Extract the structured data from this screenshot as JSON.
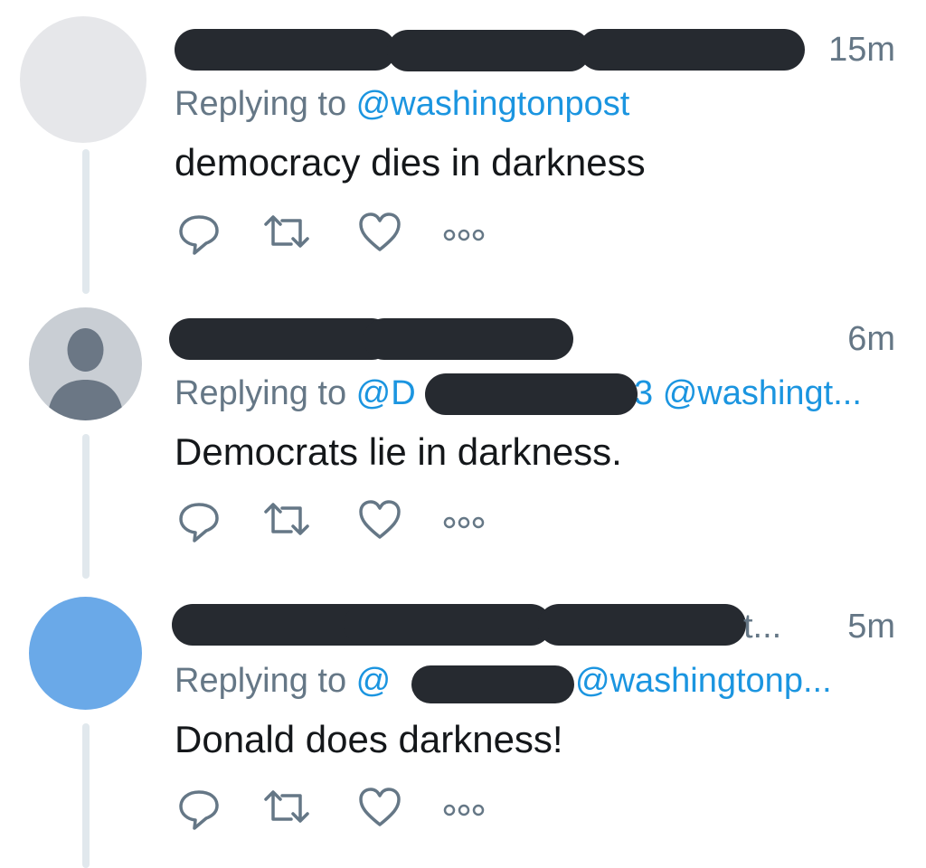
{
  "tweets": [
    {
      "time": "15m",
      "replying_prefix": "Replying to ",
      "mentions": [
        "@washingtonpost"
      ],
      "text": "democracy dies in darkness",
      "avatar_color": "#e6e7ea"
    },
    {
      "time": "6m",
      "replying_prefix": "Replying to ",
      "mentions": [
        "@D",
        "3 @washingt..."
      ],
      "text": "Democrats lie in darkness.",
      "avatar_color": "#c9ced4"
    },
    {
      "time": "5m",
      "name_tail": "t...",
      "replying_prefix": "Replying to ",
      "mentions": [
        "@",
        "@washingtonp..."
      ],
      "text": "Donald does darkness!",
      "avatar_color": "#6aa9e8"
    }
  ],
  "icons": {
    "reply": "reply-icon",
    "retweet": "retweet-icon",
    "like": "heart-icon",
    "more": "more-icon"
  },
  "colors": {
    "accent": "#1b95e0",
    "secondary_text": "#657786",
    "primary_text": "#14171a",
    "redaction": "#262a30",
    "thread_line": "#e1e8ed"
  }
}
